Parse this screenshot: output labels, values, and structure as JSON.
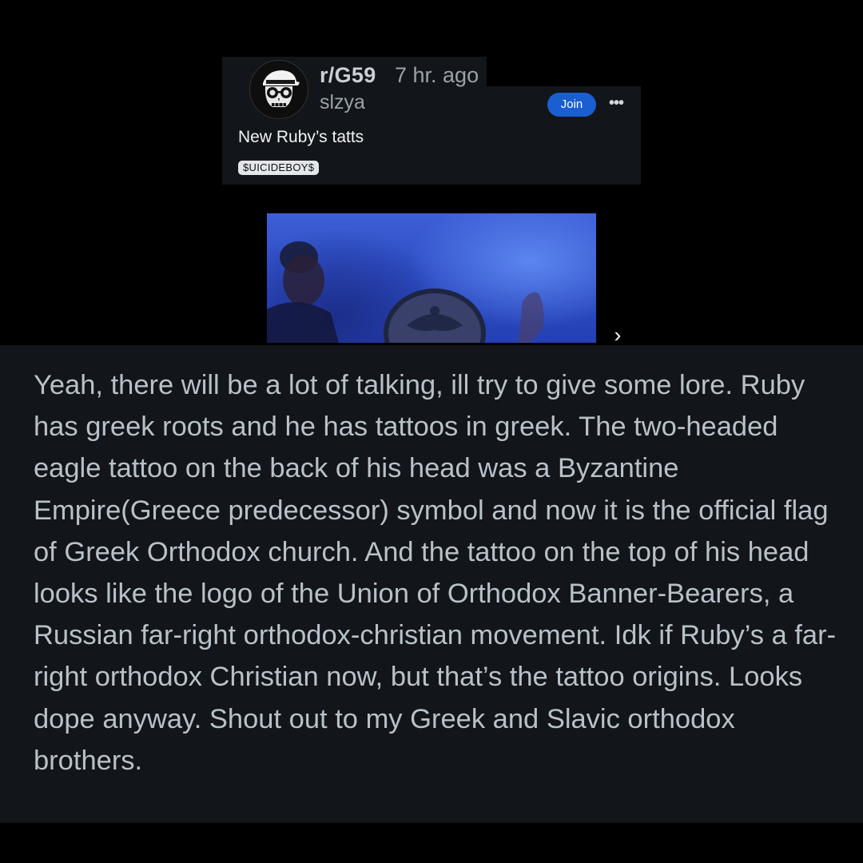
{
  "post": {
    "subreddit": "r/G59",
    "time": "7 hr. ago",
    "author": "slzya",
    "join_label": "Join",
    "more_label": "•••",
    "title": "New Ruby’s tatts",
    "flair": "$UICIDEBOY$"
  },
  "icons": {
    "avatar": "skull-avatar-icon",
    "more": "more-options-icon",
    "next": "chevron-right-icon"
  },
  "colors": {
    "join_button": "#1a5ed1",
    "card_background": "#121519",
    "page_background": "#000000",
    "comment_text": "#b8c1c9"
  },
  "media": {
    "next_label": "›"
  },
  "comment": {
    "text": "Yeah, there will be a lot of talking, ill try to give some lore. Ruby has greek roots and he has tattoos in greek. The two-headed eagle tattoo on the back of his head was a Byzantine Empire(Greece predecessor) symbol and now it is the official flag of Greek Orthodox church. And the tattoo on the top of his head looks like the logo of the Union of Orthodox Banner-Bearers, a Russian far-right orthodox-christian movement. Idk if Ruby’s a far-right orthodox Christian now, but that’s the tattoo origins. Looks dope anyway. Shout out to my Greek and Slavic orthodox brothers."
  }
}
